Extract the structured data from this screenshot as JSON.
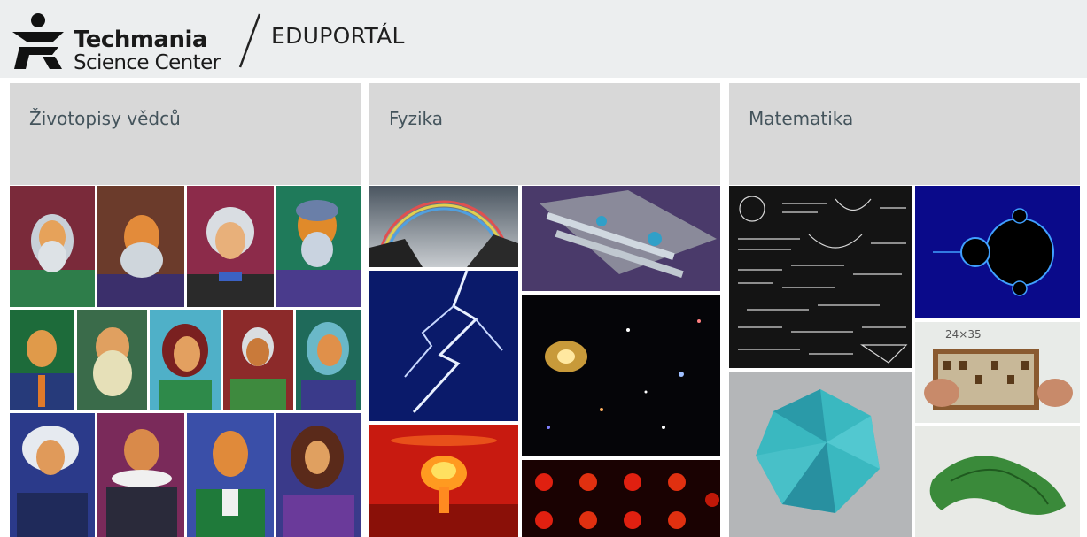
{
  "header": {
    "logo_line1": "Techmania",
    "logo_line2": "Science Center",
    "portal_title": "EDUPORTÁL"
  },
  "cards": [
    {
      "title": "Životopisy vědců"
    },
    {
      "title": "Fyzika"
    },
    {
      "title": "Matematika"
    }
  ],
  "math_tile_text": "24×35",
  "colors": {
    "header_bg": "#eceeef",
    "card_header_bg": "#d8d8d8",
    "card_title": "#44545c"
  }
}
